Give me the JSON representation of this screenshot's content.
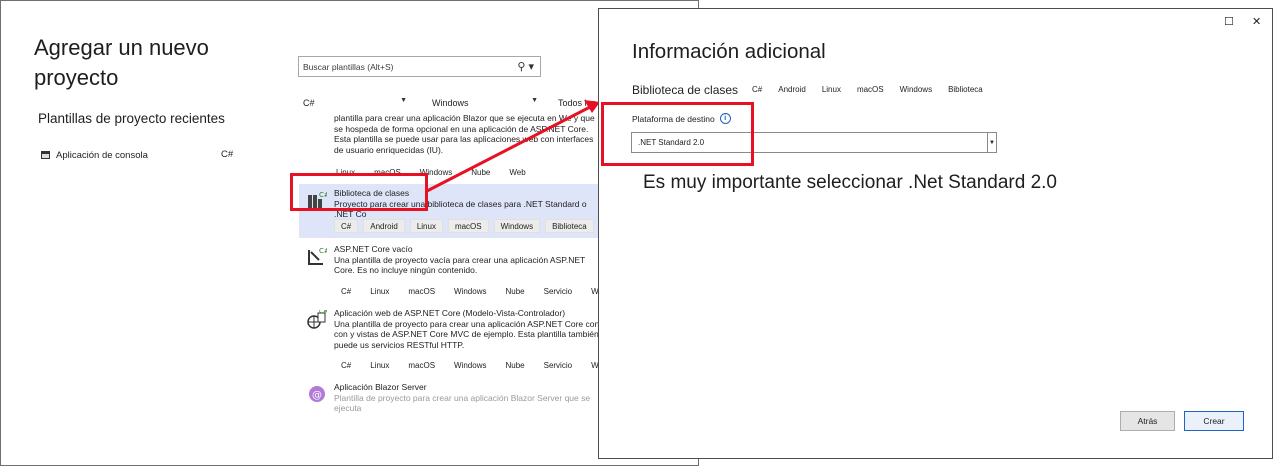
{
  "left": {
    "title": "Agregar un nuevo proyecto",
    "recent_heading": "Plantillas de proyecto recientes",
    "recent_item": {
      "label": "Aplicación de consola",
      "lang": "C#"
    },
    "search_placeholder": "Buscar plantillas (Alt+S)",
    "filters": {
      "language": "C#",
      "platform": "Windows",
      "type": "Todos los ti"
    },
    "templates": [
      {
        "title": "",
        "desc": "plantilla para crear una aplicación Blazor que se ejecuta en We y que se hospeda de forma opcional en una aplicación de ASP.NET Core. Esta plantilla se puede usar para las aplicaciones web con interfaces de usuario enriquecidas (IU).",
        "tags": [
          "Linux",
          "macOS",
          "Windows",
          "Nube",
          "Web"
        ]
      },
      {
        "title": "Biblioteca de clases",
        "desc": "Proyecto para crear una biblioteca de clases para .NET Standard o .NET Co",
        "tags": [
          "C#",
          "Android",
          "Linux",
          "macOS",
          "Windows",
          "Biblioteca"
        ]
      },
      {
        "title": "ASP.NET Core vacío",
        "desc": "Una plantilla de proyecto vacía para crear una aplicación ASP.NET Core. Es no incluye ningún contenido.",
        "tags": [
          "C#",
          "Linux",
          "macOS",
          "Windows",
          "Nube",
          "Servicio",
          "Web"
        ]
      },
      {
        "title": "Aplicación web de ASP.NET Core (Modelo-Vista-Controlador)",
        "desc": "Una plantilla de proyecto para crear una aplicación ASP.NET Core con con y vistas de ASP.NET Core MVC de ejemplo. Esta plantilla también puede us servicios RESTful HTTP.",
        "tags": [
          "C#",
          "Linux",
          "macOS",
          "Windows",
          "Nube",
          "Servicio",
          "Web"
        ]
      },
      {
        "title": "Aplicación Blazor Server",
        "desc": "Plantilla de proyecto para crear una aplicación Blazor Server que se ejecuta",
        "tags": []
      }
    ]
  },
  "right": {
    "window_controls": {
      "maximize": "☐",
      "close": "✕"
    },
    "title": "Información adicional",
    "subtitle": "Biblioteca de clases",
    "tags": [
      "C#",
      "Android",
      "Linux",
      "macOS",
      "Windows",
      "Biblioteca"
    ],
    "platform_label": "Plataforma de destino",
    "platform_value": ".NET Standard 2.0",
    "note": "Es muy importante seleccionar .Net Standard 2.0",
    "buttons": {
      "back": "Atrás",
      "create": "Crear"
    }
  },
  "colors": {
    "highlight": "#e81123",
    "selected_row": "#dfe5f8",
    "primary_border": "#1f63c6"
  }
}
